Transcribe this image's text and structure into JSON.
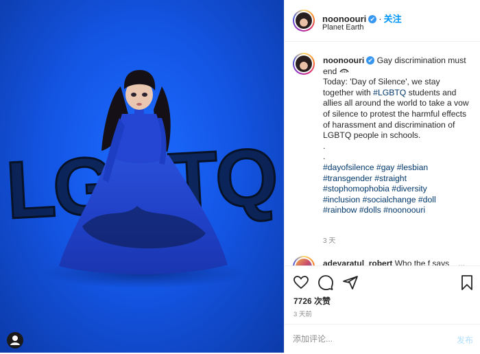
{
  "post": {
    "username": "noonoouri",
    "verified_mark": "✔",
    "follow_label": "关注",
    "location": "Planet Earth"
  },
  "image": {
    "graffiti_text": "LGBTQ",
    "background_color": "#1456e6",
    "profile_icon": "user-silhouette-icon"
  },
  "caption": {
    "username": "noonoouri",
    "line_intro": "Gay discrimination must end",
    "emoji_name": "zipper-mouth-icon",
    "body": "Today: 'Day of Silence', we stay together with",
    "body_hashtag": "#LGBTQ",
    "body_rest": "students and allies all around the world to take a vow of silence to protest the harmful effects of harassment and discrimination of LGBTQ people in schools.",
    "dots": [
      ".",
      "."
    ],
    "hashtags": [
      "#dayofsilence",
      "#gay",
      "#lesbian",
      "#transgender",
      "#straight",
      "#stophomophobia",
      "#diversity",
      "#inclusion",
      "#socialchange",
      "#doll",
      "#rainbow",
      "#dolls",
      "#noonoouri"
    ],
    "time": "3 天"
  },
  "comment": {
    "username": "adeyaratul_robert",
    "text": "Who the f says",
    "more": "..."
  },
  "actions": {
    "like_icon": "heart-icon",
    "comment_icon": "comment-icon",
    "share_icon": "send-icon",
    "save_icon": "bookmark-icon",
    "likes": "7726 次赞",
    "age": "3 天前"
  },
  "comment_bar": {
    "placeholder": "添加评论...",
    "post_label": "发布"
  },
  "colors": {
    "link": "#0095f6",
    "hashtag": "#00376b",
    "verified": "#3897f0"
  }
}
